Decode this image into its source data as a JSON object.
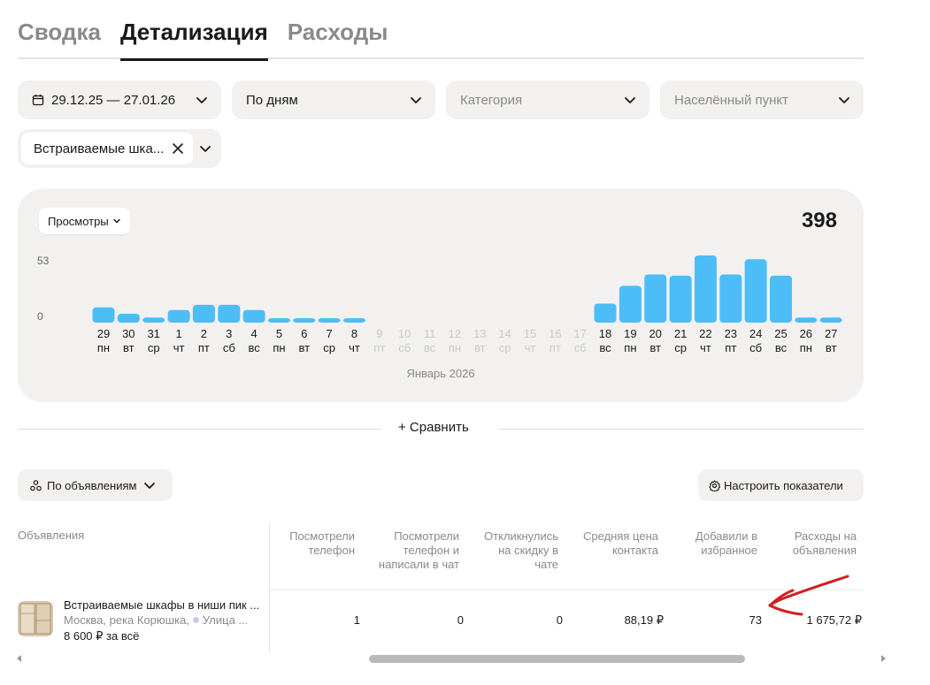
{
  "tabs": [
    {
      "label": "Сводка",
      "active": false
    },
    {
      "label": "Детализация",
      "active": true
    },
    {
      "label": "Расходы",
      "active": false
    }
  ],
  "filters": {
    "date_range": "29.12.25 — 27.01.26",
    "grouping": "По дням",
    "category_placeholder": "Категория",
    "city_placeholder": "Населённый пункт",
    "ad_chip": "Встраиваемые шка..."
  },
  "chart": {
    "metric_label": "Просмотры",
    "total": "398",
    "ytick_top": "53",
    "ytick_zero": "0",
    "month_label": "Январь 2026"
  },
  "chart_data": {
    "type": "bar",
    "title": "",
    "xlabel": "Январь 2026",
    "ylabel": "",
    "ylim": [
      0,
      53
    ],
    "categories": [
      "29",
      "30",
      "31",
      "1",
      "2",
      "3",
      "4",
      "5",
      "6",
      "7",
      "8",
      "9",
      "10",
      "11",
      "12",
      "13",
      "14",
      "15",
      "16",
      "17",
      "18",
      "19",
      "20",
      "21",
      "22",
      "23",
      "24",
      "25",
      "26",
      "27"
    ],
    "weekdays": [
      "пн",
      "вт",
      "ср",
      "чт",
      "пт",
      "сб",
      "вс",
      "пн",
      "вт",
      "ср",
      "чт",
      "пт",
      "сб",
      "вс",
      "пн",
      "вт",
      "ср",
      "чт",
      "пт",
      "сб",
      "вс",
      "пн",
      "вт",
      "ср",
      "чт",
      "пт",
      "сб",
      "вс",
      "пн",
      "вт"
    ],
    "values": [
      12,
      7,
      4,
      10,
      14,
      14,
      10,
      2,
      3,
      2,
      2,
      0,
      0,
      0,
      0,
      0,
      0,
      0,
      0,
      0,
      15,
      29,
      38,
      37,
      53,
      38,
      50,
      37,
      4,
      4
    ],
    "available": [
      true,
      true,
      true,
      true,
      true,
      true,
      true,
      true,
      true,
      true,
      true,
      false,
      false,
      false,
      false,
      false,
      false,
      false,
      false,
      false,
      true,
      true,
      true,
      true,
      true,
      true,
      true,
      true,
      true,
      true
    ],
    "bar_color": "#4dbdf7",
    "disabled_label_color": "#c9c9c9"
  },
  "compare_label": "+ Сравнить",
  "group_by_label": "По объявлениям",
  "configure_label": "Настроить показатели",
  "table": {
    "columns": [
      "Объявления",
      "Посмотрели телефон",
      "Посмотрели телефон и написали в чат",
      "Откликнулись на скидку в чате",
      "Средняя цена контакта",
      "Добавили в избранное",
      "Расходы на объявления"
    ],
    "row": {
      "title": "Встраиваемые шкафы в ниши пик ...",
      "location_city": "Москва, река Корюшка,",
      "location_street": "Улица ...",
      "price": "8 600 ₽ за всё",
      "phone_views": "1",
      "phone_and_chat": "0",
      "discount_replies": "0",
      "avg_contact_price": "88,19 ₽",
      "favorites": "73",
      "spend": "1 675,72 ₽"
    }
  },
  "colors": {
    "accent_bar": "#4dbdf7",
    "panel_bg": "#f2f1f0",
    "annotation": "#d21f1f"
  }
}
